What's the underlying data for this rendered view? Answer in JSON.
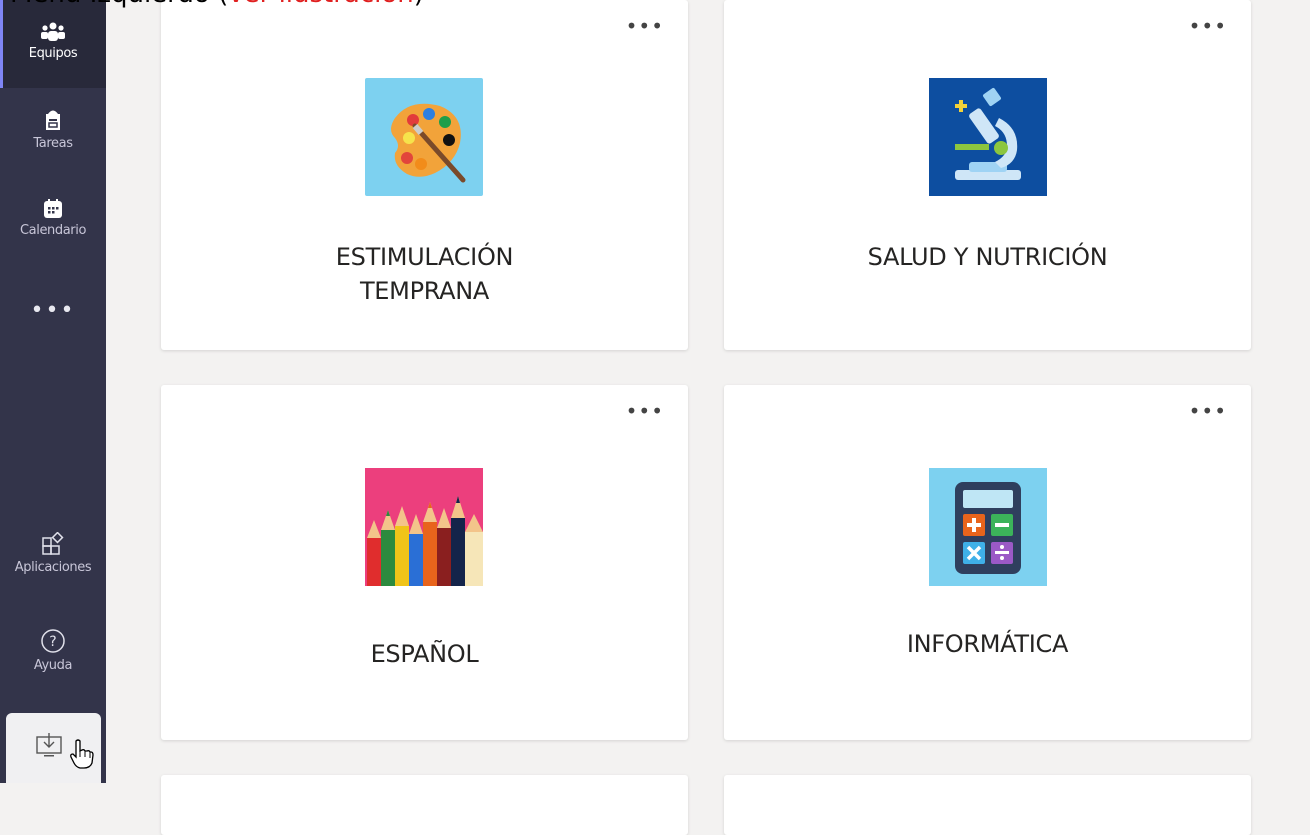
{
  "caption": {
    "text_before": "Menú Izquierdo (",
    "text_highlight": "ver ilustración",
    "text_after": ")"
  },
  "sidebar": {
    "items": [
      {
        "label": "Equipos",
        "icon": "teams-icon"
      },
      {
        "label": "Tareas",
        "icon": "assignments-icon"
      },
      {
        "label": "Calendario",
        "icon": "calendar-icon"
      },
      {
        "label": "•••",
        "icon": "more-icon"
      },
      {
        "label": "Aplicaciones",
        "icon": "apps-icon"
      },
      {
        "label": "Ayuda",
        "icon": "help-icon"
      },
      {
        "label": "",
        "icon": "download-icon"
      }
    ]
  },
  "teams": [
    {
      "name_line1": "ESTIMULACIÓN",
      "name_line2": "TEMPRANA",
      "more": "•••",
      "thumb": "palette-icon"
    },
    {
      "name_line1": "SALUD Y NUTRICIÓN",
      "name_line2": "",
      "more": "•••",
      "thumb": "microscope-icon"
    },
    {
      "name_line1": "ESPAÑOL",
      "name_line2": "",
      "more": "•••",
      "thumb": "pencils-icon"
    },
    {
      "name_line1": "INFORMÁTICA",
      "name_line2": "",
      "more": "•••",
      "thumb": "calculator-icon"
    }
  ],
  "colors": {
    "sidebar_bg": "#33344a",
    "content_bg": "#f3f2f1",
    "accent": "#7f85f5"
  }
}
